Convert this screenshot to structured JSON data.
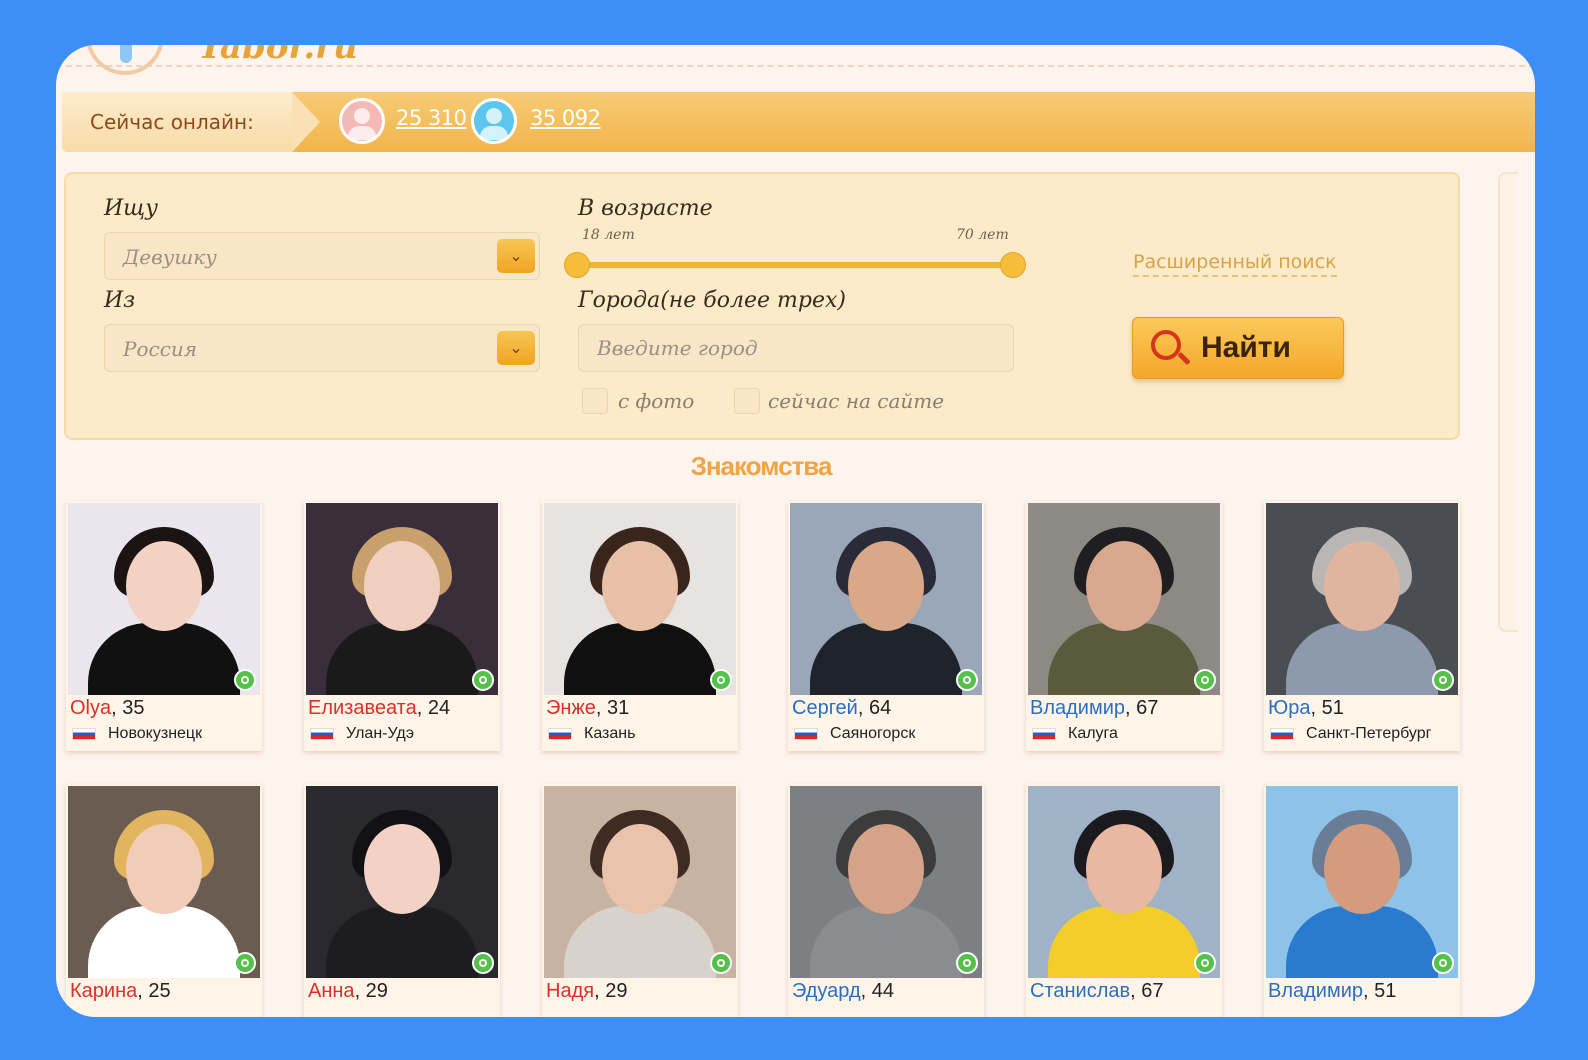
{
  "site": {
    "logo_text": "Tabor.ru"
  },
  "online": {
    "label": "Сейчас онлайн:",
    "female_count": "25 310",
    "male_count": "35 092"
  },
  "search": {
    "seek_label": "Ищу",
    "seek_value": "Девушку",
    "from_label": "Из",
    "from_value": "Россия",
    "age_label": "В возрасте",
    "age_min": "18 лет",
    "age_max": "70 лет",
    "cities_label": "Города(не более трех)",
    "city_placeholder": "Введите город",
    "with_photo_label": "с фото",
    "online_now_label": "сейчас на сайте",
    "advanced_link": "Расширенный поиск",
    "find_button": "Найти"
  },
  "section_title": "Знакомства",
  "profiles": [
    {
      "name": "Olya",
      "age": ", 35",
      "city": "Новокузнецк",
      "gender": "f"
    },
    {
      "name": "Елизавеата",
      "age": ", 24",
      "city": "Улан-Удэ",
      "gender": "f"
    },
    {
      "name": "Энже",
      "age": ", 31",
      "city": "Казань",
      "gender": "f"
    },
    {
      "name": "Сергей",
      "age": ", 64",
      "city": "Саяногорск",
      "gender": "m"
    },
    {
      "name": "Владимир",
      "age": ", 67",
      "city": "Калуга",
      "gender": "m"
    },
    {
      "name": "Юра",
      "age": ", 51",
      "city": "Санкт-Петербург",
      "gender": "m"
    },
    {
      "name": "Карина",
      "age": ", 25",
      "city": "",
      "gender": "f"
    },
    {
      "name": "Анна",
      "age": ", 29",
      "city": "",
      "gender": "f"
    },
    {
      "name": "Надя",
      "age": ", 29",
      "city": "",
      "gender": "f"
    },
    {
      "name": "Эдуард",
      "age": ", 44",
      "city": "",
      "gender": "m"
    },
    {
      "name": "Станислав",
      "age": ", 67",
      "city": "",
      "gender": "m"
    },
    {
      "name": "Владимир",
      "age": ", 51",
      "city": "",
      "gender": "m"
    }
  ],
  "colors": {
    "page_bg": "#3d8ef5",
    "accent_orange": "#f2b44c",
    "female_name": "#d9302a",
    "male_name": "#2a6fbf"
  }
}
